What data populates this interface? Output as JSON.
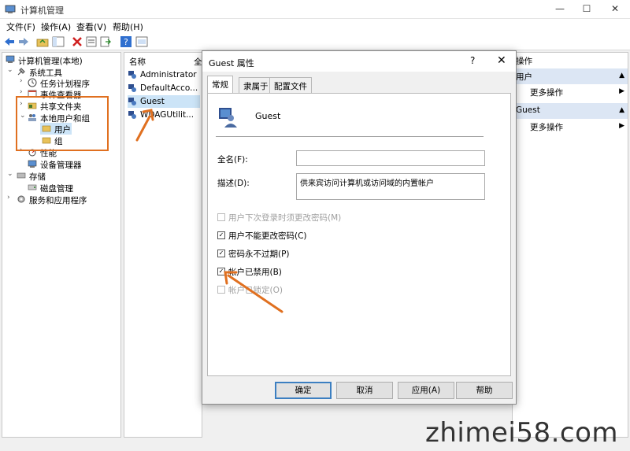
{
  "window": {
    "title": "计算机管理",
    "minimize": "—",
    "maximize": "☐",
    "close": "✕"
  },
  "menu": [
    "文件(F)",
    "操作(A)",
    "查看(V)",
    "帮助(H)"
  ],
  "tree": [
    {
      "label": "计算机管理(本地)",
      "icon": "computer-icon"
    },
    {
      "label": "系统工具",
      "icon": "tools-icon",
      "arrow": "⌄"
    },
    {
      "label": "任务计划程序",
      "icon": "clock-icon",
      "arrow": "›"
    },
    {
      "label": "事件查看器",
      "icon": "event-icon",
      "arrow": "›"
    },
    {
      "label": "共享文件夹",
      "icon": "folder-icon",
      "arrow": "›"
    },
    {
      "label": "本地用户和组",
      "icon": "users-icon",
      "arrow": "⌄"
    },
    {
      "label": "用户",
      "icon": "folder-icon"
    },
    {
      "label": "组",
      "icon": "folder-icon"
    },
    {
      "label": "性能",
      "icon": "performance-icon",
      "arrow": "›"
    },
    {
      "label": "设备管理器",
      "icon": "device-icon"
    },
    {
      "label": "存储",
      "icon": "storage-icon",
      "arrow": "⌄"
    },
    {
      "label": "磁盘管理",
      "icon": "disk-icon"
    },
    {
      "label": "服务和应用程序",
      "icon": "services-icon",
      "arrow": "›"
    }
  ],
  "list": {
    "header_name": "名称",
    "header_full": "全",
    "items": [
      "Administrator",
      "DefaultAcco...",
      "Guest",
      "WDAGUtilit..."
    ]
  },
  "actions": {
    "header": "操作",
    "section1": "用户",
    "more1": "更多操作",
    "section2": "Guest",
    "more2": "更多操作"
  },
  "dialog": {
    "title": "Guest 属性",
    "help": "?",
    "close": "✕",
    "tabs": [
      "常规",
      "隶属于",
      "配置文件"
    ],
    "username": "Guest",
    "fullname_label": "全名(F):",
    "fullname_value": "",
    "desc_label": "描述(D):",
    "desc_value": "供来宾访问计算机或访问域的内置帐户",
    "checkboxes": [
      {
        "label": "用户下次登录时须更改密码(M)",
        "checked": false,
        "enabled": false
      },
      {
        "label": "用户不能更改密码(C)",
        "checked": true,
        "enabled": true
      },
      {
        "label": "密码永不过期(P)",
        "checked": true,
        "enabled": true
      },
      {
        "label": "帐户已禁用(B)",
        "checked": true,
        "enabled": true
      },
      {
        "label": "帐户已锁定(O)",
        "checked": false,
        "enabled": false
      }
    ],
    "buttons": [
      "确定",
      "取消",
      "应用(A)",
      "帮助"
    ]
  },
  "watermark": "zhimei58.com",
  "colors": {
    "annotation": "#e07020",
    "selection": "#cce4f7",
    "accent": "#3c7fc1"
  }
}
